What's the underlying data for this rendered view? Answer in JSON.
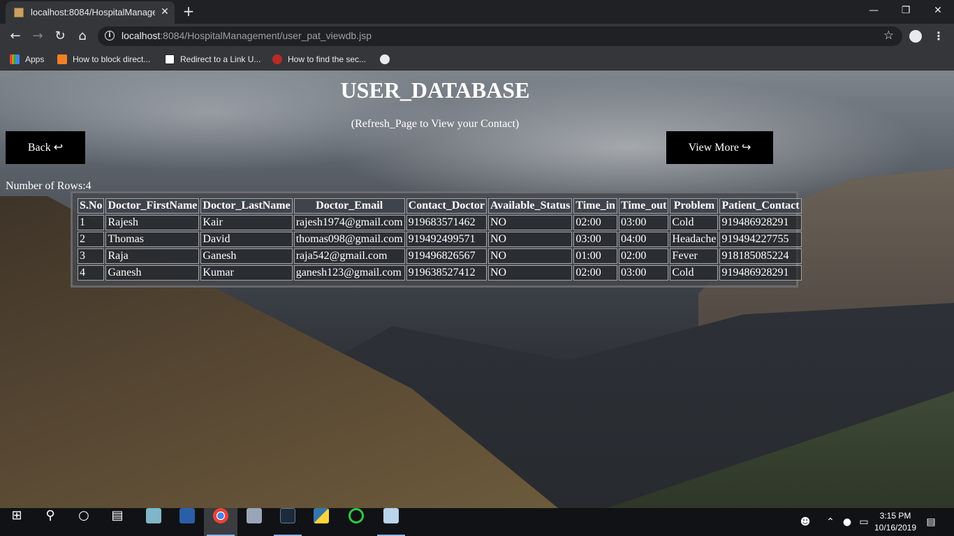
{
  "browser": {
    "tab_title": "localhost:8084/HospitalManagem",
    "tab_close": "✕",
    "new_tab": "+",
    "url_host": "localhost",
    "url_rest": ":8084/HospitalManagement/user_pat_viewdb.jsp",
    "bookmarks": [
      {
        "label": "Apps",
        "icon": "apps-grid-icon",
        "color": "#e9a23b"
      },
      {
        "label": "How to block direct...",
        "icon": "stackoverflow-icon",
        "color": "#f48024"
      },
      {
        "label": "Redirect to a Link U...",
        "icon": "codepen-icon",
        "color": "#ffffff"
      },
      {
        "label": "How to find the sec...",
        "icon": "quora-icon",
        "color": "#b92b27"
      },
      {
        "label": "",
        "icon": "globe-icon",
        "color": "#e8eaed"
      }
    ]
  },
  "page": {
    "title": "USER_DATABASE",
    "subtitle": "(Refresh_Page to View your Contact)",
    "back_label": "Back ↩",
    "view_more_label": "View More ↪",
    "rows_count": "Number of Rows:4"
  },
  "table": {
    "headers": [
      "S.No",
      "Doctor_FirstName",
      "Doctor_LastName",
      "Doctor_Email",
      "Contact_Doctor",
      "Available_Status",
      "Time_in",
      "Time_out",
      "Problem",
      "Patient_Contact"
    ],
    "rows": [
      [
        "1",
        "Rajesh",
        "Kair",
        "rajesh1974@gmail.com",
        "919683571462",
        "NO",
        "02:00",
        "03:00",
        "Cold",
        "919486928291"
      ],
      [
        "2",
        "Thomas",
        "David",
        "thomas098@gmail.com",
        "919492499571",
        "NO",
        "03:00",
        "04:00",
        "Headache",
        "919494227755"
      ],
      [
        "3",
        "Raja",
        "Ganesh",
        "raja542@gmail.com",
        "919496826567",
        "NO",
        "01:00",
        "02:00",
        "Fever",
        "918185085224"
      ],
      [
        "4",
        "Ganesh",
        "Kumar",
        "ganesh123@gmail.com",
        "919638527412",
        "NO",
        "02:00",
        "03:00",
        "Cold",
        "919486928291"
      ]
    ]
  },
  "taskbar": {
    "time": "3:15 PM",
    "date": "10/16/2019"
  }
}
